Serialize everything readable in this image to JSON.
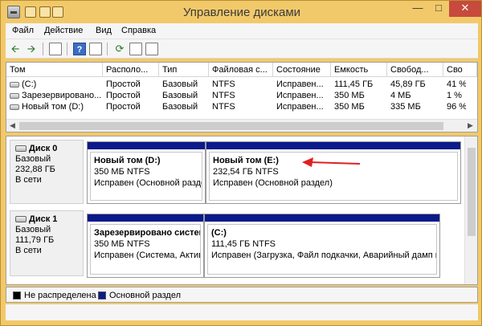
{
  "window": {
    "title": "Управление дисками"
  },
  "menu": [
    "Файл",
    "Действие",
    "Вид",
    "Справка"
  ],
  "icons": {
    "back": "arrow-left-icon",
    "forward": "arrow-right-icon",
    "props": "properties-icon",
    "help": "help-icon",
    "help_glyph": "?",
    "refresh": "refresh-icon"
  },
  "colors": {
    "primary_partition": "#0a1a8a",
    "unallocated": "#000000"
  },
  "volumes": {
    "columns": [
      "Том",
      "Располо...",
      "Тип",
      "Файловая с...",
      "Состояние",
      "Емкость",
      "Свобод...",
      "Сво"
    ],
    "rows": [
      [
        "(C:)",
        "Простой",
        "Базовый",
        "NTFS",
        "Исправен...",
        "111,45 ГБ",
        "45,89 ГБ",
        "41 %"
      ],
      [
        "Зарезервировано...",
        "Простой",
        "Базовый",
        "NTFS",
        "Исправен...",
        "350 МБ",
        "4 МБ",
        "1 %"
      ],
      [
        "Новый том (D:)",
        "Простой",
        "Базовый",
        "NTFS",
        "Исправен...",
        "350 МБ",
        "335 МБ",
        "96 %"
      ]
    ]
  },
  "disks": [
    {
      "name": "Диск 0",
      "type": "Базовый",
      "size": "232,88 ГБ",
      "status": "В сети",
      "partitions": [
        {
          "name": "Новый том  (D:)",
          "size": "350 МБ NTFS",
          "status": "Исправен (Основной разде"
        },
        {
          "name": "Новый том  (E:)",
          "size": "232,54 ГБ NTFS",
          "status": "Исправен (Основной раздел)"
        }
      ]
    },
    {
      "name": "Диск 1",
      "type": "Базовый",
      "size": "111,79 ГБ",
      "status": "В сети",
      "partitions": [
        {
          "name": "Зарезервировано систем",
          "size": "350 МБ NTFS",
          "status": "Исправен (Система, Актив"
        },
        {
          "name": "(C:)",
          "size": "111,45 ГБ NTFS",
          "status": "Исправен (Загрузка, Файл подкачки, Аварийный дамп г"
        }
      ]
    }
  ],
  "legend": [
    {
      "label": "Не распределена"
    },
    {
      "label": "Основной раздел"
    }
  ]
}
